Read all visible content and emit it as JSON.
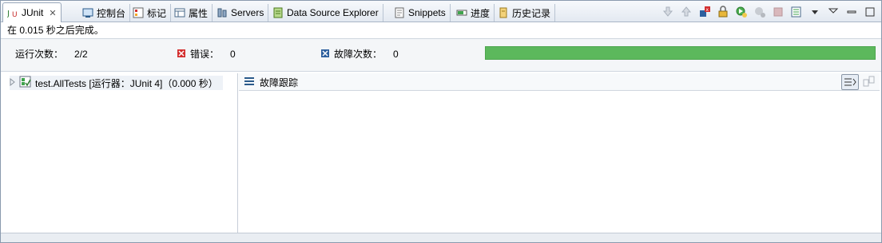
{
  "tabs": [
    {
      "label": "JUnit",
      "icon": "junit-icon",
      "close": "✕"
    },
    {
      "label": "控制台",
      "icon": "console-icon"
    },
    {
      "label": "标记",
      "icon": "markers-icon"
    },
    {
      "label": "属性",
      "icon": "properties-icon"
    },
    {
      "label": "Servers",
      "icon": "servers-icon"
    },
    {
      "label": "Data Source Explorer",
      "icon": "data-source-icon"
    },
    {
      "label": "Snippets",
      "icon": "snippets-icon"
    },
    {
      "label": "进度",
      "icon": "progress-icon"
    },
    {
      "label": "历史记录",
      "icon": "history-icon"
    }
  ],
  "status": "在 0.015 秒之后完成。",
  "counters": {
    "runs_label": "运行次数：",
    "runs_value": "2/2",
    "errors_label": "错误：",
    "errors_value": "0",
    "failures_label": "故障次数：",
    "failures_value": "0"
  },
  "progress": {
    "fraction": 1.0,
    "color": "#5cb85c"
  },
  "tree": {
    "root_label": "test.AllTests [运行器：JUnit 4]（0.000 秒）"
  },
  "trace": {
    "title": "故障跟踪"
  }
}
